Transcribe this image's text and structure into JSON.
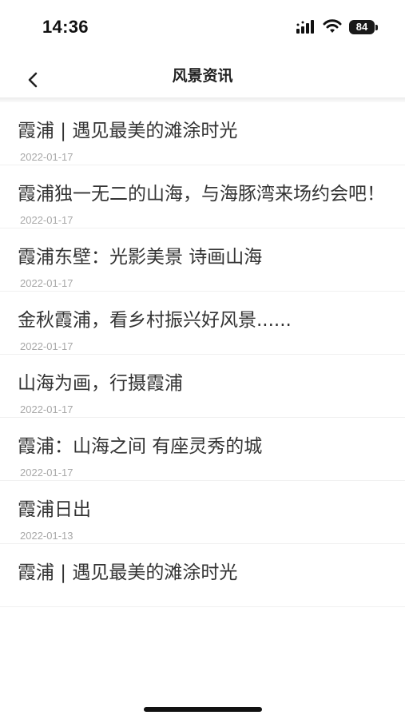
{
  "status_bar": {
    "time": "14:36",
    "battery": "84"
  },
  "header": {
    "title": "风景资讯",
    "back_icon": "chevron-left-icon"
  },
  "news": [
    {
      "title": "霞浦 | 遇见最美的滩涂时光",
      "date": "2022-01-17"
    },
    {
      "title": "霞浦独一无二的山海，与海豚湾来场约会吧！",
      "date": "2022-01-17"
    },
    {
      "title": "霞浦东壁：光影美景 诗画山海",
      "date": "2022-01-17"
    },
    {
      "title": "金秋霞浦，看乡村振兴好风景......",
      "date": "2022-01-17"
    },
    {
      "title": "山海为画，行摄霞浦",
      "date": "2022-01-17"
    },
    {
      "title": "霞浦：山海之间 有座灵秀的城",
      "date": "2022-01-17"
    },
    {
      "title": "霞浦日出",
      "date": "2022-01-13"
    },
    {
      "title": "霞浦 | 遇见最美的滩涂时光",
      "date": ""
    }
  ]
}
